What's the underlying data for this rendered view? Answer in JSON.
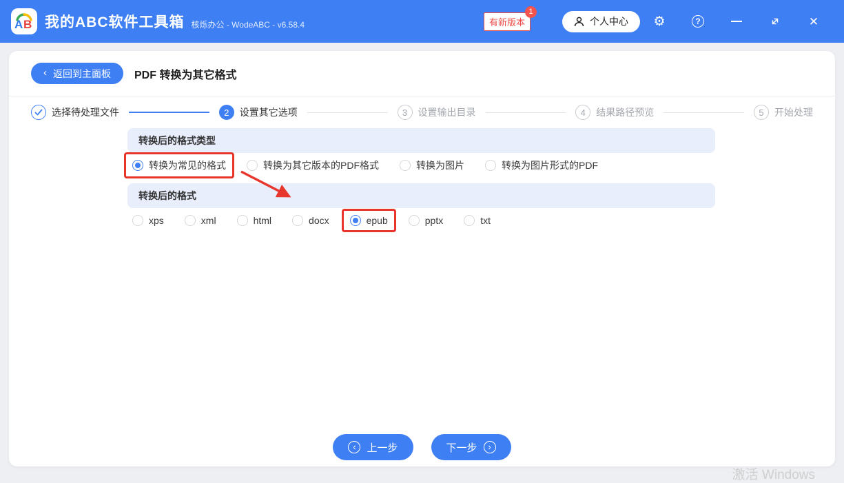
{
  "colors": {
    "accent": "#3e7ff4",
    "annotation_red": "#e7372c",
    "badge_red": "#ef4b45",
    "band_blue": "#e8eefc"
  },
  "header": {
    "logo_text": "AB",
    "app_title": "我的ABC软件工具箱",
    "app_subtitle": "核烁办公 - WodeABC - v6.58.4",
    "new_version_label": "有新版本",
    "new_version_count": "1",
    "user_center_label": "个人中心"
  },
  "toolbar": {
    "back_label": "返回到主面板",
    "page_title": "PDF 转换为其它格式"
  },
  "steps": [
    {
      "number": "1",
      "label": "选择待处理文件",
      "state": "done"
    },
    {
      "number": "2",
      "label": "设置其它选项",
      "state": "active"
    },
    {
      "number": "3",
      "label": "设置输出目录",
      "state": "pending"
    },
    {
      "number": "4",
      "label": "结果路径预览",
      "state": "pending"
    },
    {
      "number": "5",
      "label": "开始处理",
      "state": "pending"
    }
  ],
  "groups": [
    {
      "title": "转换后的格式类型",
      "options": [
        {
          "label": "转换为常见的格式",
          "selected": true,
          "annotated": true
        },
        {
          "label": "转换为其它版本的PDF格式",
          "selected": false,
          "annotated": false
        },
        {
          "label": "转换为图片",
          "selected": false,
          "annotated": false
        },
        {
          "label": "转换为图片形式的PDF",
          "selected": false,
          "annotated": false
        }
      ]
    },
    {
      "title": "转换后的格式",
      "options": [
        {
          "label": "xps",
          "selected": false,
          "annotated": false
        },
        {
          "label": "xml",
          "selected": false,
          "annotated": false
        },
        {
          "label": "html",
          "selected": false,
          "annotated": false
        },
        {
          "label": "docx",
          "selected": false,
          "annotated": false
        },
        {
          "label": "epub",
          "selected": true,
          "annotated": true
        },
        {
          "label": "pptx",
          "selected": false,
          "annotated": false
        },
        {
          "label": "txt",
          "selected": false,
          "annotated": false
        }
      ]
    }
  ],
  "footer": {
    "prev_label": "上一步",
    "next_label": "下一步"
  },
  "watermark": "激活 Windows"
}
